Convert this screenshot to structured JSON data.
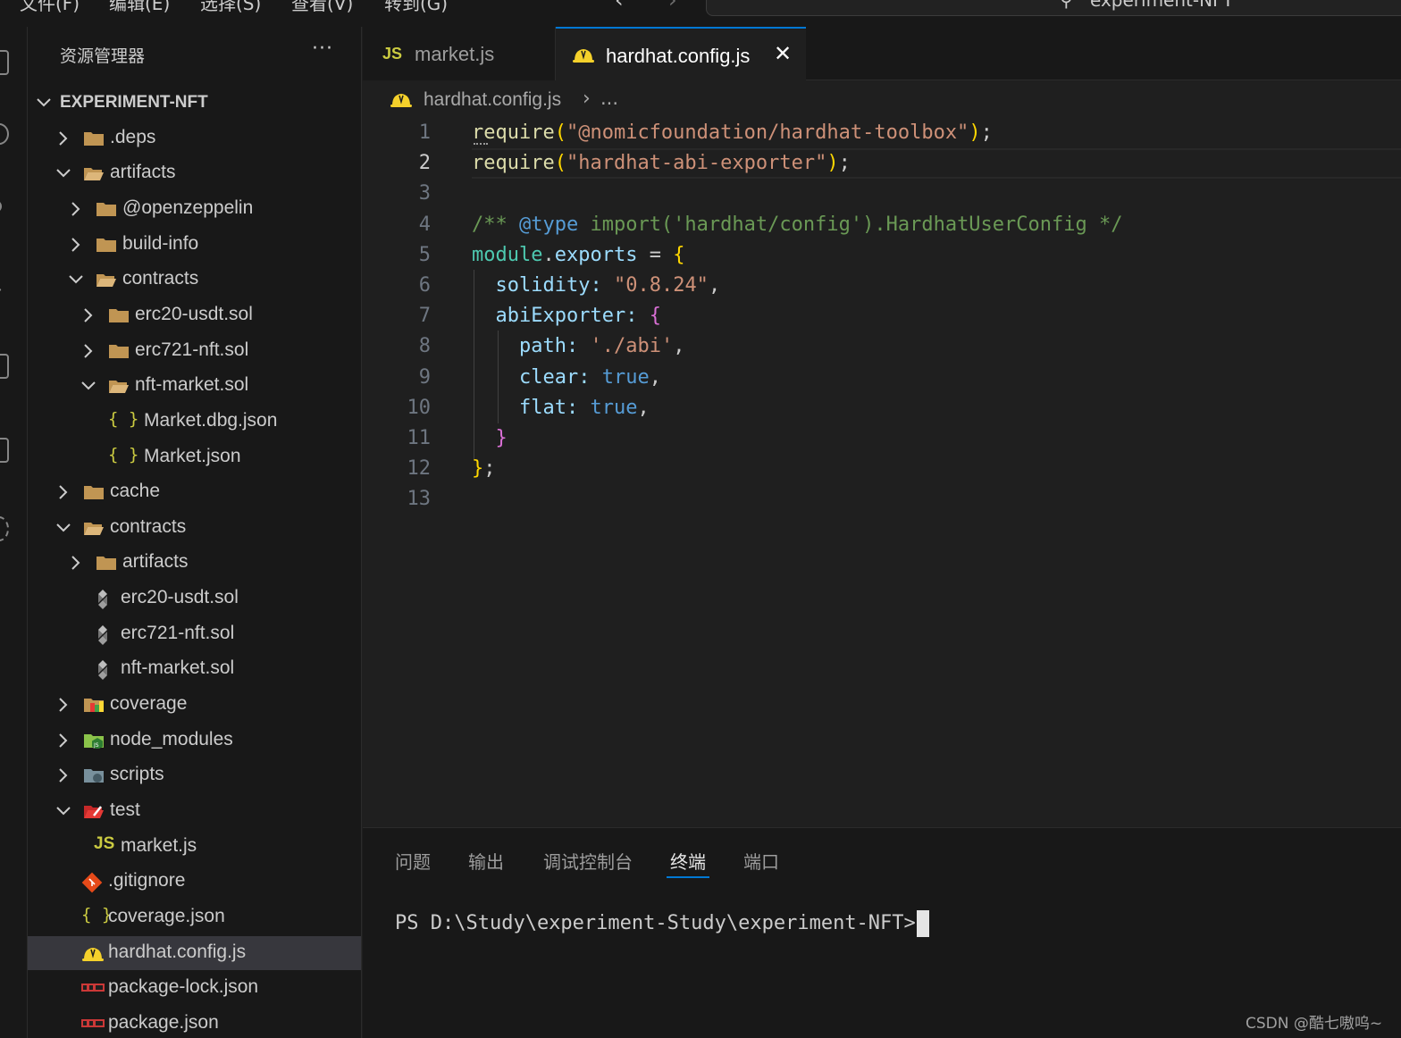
{
  "menubar": {
    "items": [
      "文件(F)",
      "编辑(E)",
      "选择(S)",
      "查看(V)",
      "转到(G)"
    ],
    "search_text": "experiment-NFT",
    "back_icon": "arrow-left-icon",
    "forward_icon": "arrow-right-icon"
  },
  "sidebar": {
    "title": "资源管理器",
    "more": "···",
    "root": "EXPERIMENT-NFT",
    "tree": [
      {
        "label": ".deps",
        "kind": "folder",
        "state": "collapsed"
      },
      {
        "label": "artifacts",
        "kind": "folder",
        "state": "expanded"
      },
      {
        "label": "@openzeppelin",
        "kind": "folder",
        "state": "collapsed"
      },
      {
        "label": "build-info",
        "kind": "folder",
        "state": "collapsed"
      },
      {
        "label": "contracts",
        "kind": "folder",
        "state": "expanded"
      },
      {
        "label": "erc20-usdt.sol",
        "kind": "folder",
        "state": "collapsed"
      },
      {
        "label": "erc721-nft.sol",
        "kind": "folder",
        "state": "collapsed"
      },
      {
        "label": "nft-market.sol",
        "kind": "folder",
        "state": "expanded"
      },
      {
        "label": "Market.dbg.json",
        "kind": "json"
      },
      {
        "label": "Market.json",
        "kind": "json"
      },
      {
        "label": "cache",
        "kind": "folder",
        "state": "collapsed"
      },
      {
        "label": "contracts",
        "kind": "folder",
        "state": "expanded"
      },
      {
        "label": "artifacts",
        "kind": "folder",
        "state": "collapsed"
      },
      {
        "label": "erc20-usdt.sol",
        "kind": "solidity"
      },
      {
        "label": "erc721-nft.sol",
        "kind": "solidity"
      },
      {
        "label": "nft-market.sol",
        "kind": "solidity"
      },
      {
        "label": "coverage",
        "kind": "folder-coverage",
        "state": "collapsed"
      },
      {
        "label": "node_modules",
        "kind": "folder-node",
        "state": "collapsed"
      },
      {
        "label": "scripts",
        "kind": "folder-scripts",
        "state": "collapsed"
      },
      {
        "label": "test",
        "kind": "folder-test",
        "state": "expanded"
      },
      {
        "label": "market.js",
        "kind": "js"
      },
      {
        "label": ".gitignore",
        "kind": "git"
      },
      {
        "label": "coverage.json",
        "kind": "json"
      },
      {
        "label": "hardhat.config.js",
        "kind": "hardhat",
        "selected": true
      },
      {
        "label": "package-lock.json",
        "kind": "npm"
      },
      {
        "label": "package.json",
        "kind": "npm"
      }
    ]
  },
  "tabs": [
    {
      "label": "market.js",
      "icon": "JS",
      "active": false
    },
    {
      "label": "hardhat.config.js",
      "active": true,
      "close": "✕"
    }
  ],
  "breadcrumb": {
    "file": "hardhat.config.js",
    "sep": "›",
    "more": "..."
  },
  "editor": {
    "line_numbers": [
      "1",
      "2",
      "3",
      "4",
      "5",
      "6",
      "7",
      "8",
      "9",
      "10",
      "11",
      "12",
      "13"
    ],
    "lines": [
      "require(\"@nomicfoundation/hardhat-toolbox\");",
      "require(\"hardhat-abi-exporter\");",
      "",
      "/** @type import('hardhat/config').HardhatUserConfig */",
      "module.exports = {",
      "  solidity: \"0.8.24\",",
      "  abiExporter: {",
      "    path: './abi',",
      "    clear: true,",
      "    flat: true,",
      "  }",
      "};",
      ""
    ],
    "active_line": 2
  },
  "panel": {
    "tabs": [
      "问题",
      "输出",
      "调试控制台",
      "终端",
      "端口"
    ],
    "active_tab": "终端",
    "terminal_prompt": "PS D:\\Study\\experiment-Study\\experiment-NFT> "
  },
  "watermark": "CSDN @酷七嗷呜~",
  "colors": {
    "accent": "#0078d4",
    "folder": "#c09553",
    "json": "#cbcb41",
    "string": "#ce9178",
    "function": "#dcdcaa",
    "comment": "#6a9955",
    "keyword": "#569cd6",
    "property": "#9cdcfe"
  }
}
